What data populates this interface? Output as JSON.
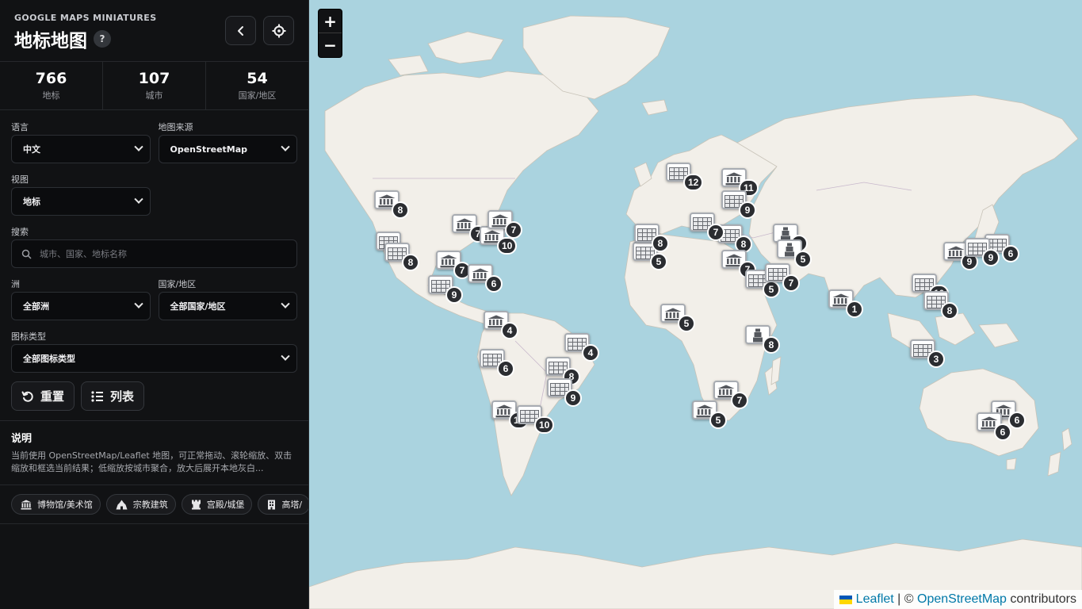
{
  "header": {
    "brand": "GOOGLE MAPS MINIATURES",
    "title": "地标地图",
    "help_icon": "?"
  },
  "stats": [
    {
      "value": "766",
      "label": "地标"
    },
    {
      "value": "107",
      "label": "城市"
    },
    {
      "value": "54",
      "label": "国家/地区"
    }
  ],
  "filters": {
    "language_label": "语言",
    "language_value": "中文",
    "map_source_label": "地图来源",
    "map_source_value": "OpenStreetMap",
    "view_label": "视图",
    "view_value": "地标",
    "search_label": "搜索",
    "search_placeholder": "城市、国家、地标名称",
    "continent_label": "洲",
    "continent_value": "全部洲",
    "country_label": "国家/地区",
    "country_value": "全部国家/地区",
    "icon_type_label": "图标类型",
    "icon_type_value": "全部图标类型"
  },
  "actions": {
    "reset_label": "重置",
    "list_label": "列表"
  },
  "description": {
    "title": "说明",
    "text": "当前使用 OpenStreetMap/Leaflet 地图，可正常拖动、滚轮缩放、双击缩放和框选当前结果；低缩放按城市聚合，放大后展开本地灰白..."
  },
  "chips": [
    {
      "icon": "museum-icon",
      "label": "博物馆/美术馆"
    },
    {
      "icon": "temple-icon",
      "label": "宗教建筑"
    },
    {
      "icon": "castle-icon",
      "label": "宫殿/城堡"
    },
    {
      "icon": "tower-icon",
      "label": "高塔/"
    }
  ],
  "map": {
    "zoom_in": "+",
    "zoom_out": "−",
    "attribution_leaflet": "Leaflet",
    "attribution_sep": " | © ",
    "attribution_osm": "OpenStreetMap",
    "attribution_rest": " contributors",
    "colors": {
      "water": "#aad3df",
      "land": "#f2efe9",
      "marker_count_bg": "#2b2d31"
    }
  },
  "markers": [
    {
      "type": "museum",
      "count": "8"
    },
    {
      "type": "grid",
      "count": "7"
    },
    {
      "type": "grid",
      "count": "8"
    },
    {
      "type": "museum",
      "count": "7"
    },
    {
      "type": "museum",
      "count": "7"
    },
    {
      "type": "museum",
      "count": "10"
    },
    {
      "type": "museum",
      "count": "7"
    },
    {
      "type": "museum",
      "count": "6"
    },
    {
      "type": "grid",
      "count": "9"
    },
    {
      "type": "museum",
      "count": "4"
    },
    {
      "type": "grid",
      "count": "6"
    },
    {
      "type": "grid",
      "count": "4"
    },
    {
      "type": "grid",
      "count": "8"
    },
    {
      "type": "grid",
      "count": "9"
    },
    {
      "type": "museum",
      "count": "11"
    },
    {
      "type": "grid",
      "count": "10"
    },
    {
      "type": "grid",
      "count": "12"
    },
    {
      "type": "museum",
      "count": "11"
    },
    {
      "type": "grid",
      "count": "9"
    },
    {
      "type": "grid",
      "count": "8"
    },
    {
      "type": "grid",
      "count": "7"
    },
    {
      "type": "grid",
      "count": "5"
    },
    {
      "type": "grid",
      "count": "8"
    },
    {
      "type": "museum",
      "count": "7"
    },
    {
      "type": "tower",
      "count": "6"
    },
    {
      "type": "tower",
      "count": "5"
    },
    {
      "type": "grid",
      "count": "5"
    },
    {
      "type": "grid",
      "count": "7"
    },
    {
      "type": "museum",
      "count": "5"
    },
    {
      "type": "tower",
      "count": "8"
    },
    {
      "type": "museum",
      "count": "7"
    },
    {
      "type": "museum",
      "count": "5"
    },
    {
      "type": "museum",
      "count": "1"
    },
    {
      "type": "grid",
      "count": "10"
    },
    {
      "type": "museum",
      "count": "9"
    },
    {
      "type": "grid",
      "count": "6"
    },
    {
      "type": "grid",
      "count": "8"
    },
    {
      "type": "grid",
      "count": "3"
    },
    {
      "type": "grid",
      "count": "9"
    },
    {
      "type": "museum",
      "count": "6"
    },
    {
      "type": "museum",
      "count": "6"
    }
  ]
}
